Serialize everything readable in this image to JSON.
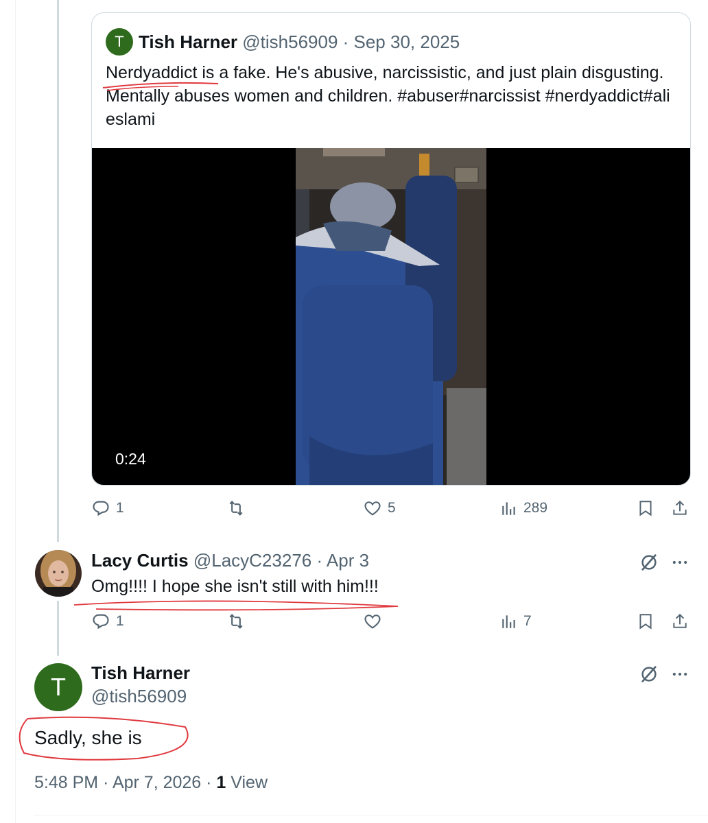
{
  "quoted_tweet": {
    "avatar_letter": "T",
    "author_name": "Tish Harner",
    "handle_date": "@tish56909 · Sep 30, 2025",
    "text": "Nerdyaddict is a fake. He's abusive,  narcissistic,  and just plain disgusting. Mentally abuses women and children. #abuser#narcissist #nerdyaddict#ali eslami",
    "video_duration": "0:24"
  },
  "quoted_actions": {
    "replies": "1",
    "reposts": "",
    "likes": "5",
    "views": "289"
  },
  "reply": {
    "author_name": "Lacy Curtis",
    "handle_date": "@LacyC23276 · Apr 3",
    "text": "Omg!!!! I hope she isn't still with him!!!",
    "replies": "1",
    "reposts": "",
    "likes": "",
    "views": "7"
  },
  "main_tweet": {
    "avatar_letter": "T",
    "author_name": "Tish Harner",
    "handle": "@tish56909",
    "text": "Sadly, she is",
    "time_date": "5:48 PM · Apr 7, 2026 · ",
    "view_count": "1",
    "view_label": " View"
  },
  "colors": {
    "avatar_green": "#2e6b1c",
    "secondary_text": "#536471",
    "annotation_red": "#e0393e"
  },
  "icons": [
    "reply-icon",
    "repost-icon",
    "like-icon",
    "views-icon",
    "bookmark-icon",
    "share-icon",
    "grok-icon",
    "more-icon"
  ]
}
